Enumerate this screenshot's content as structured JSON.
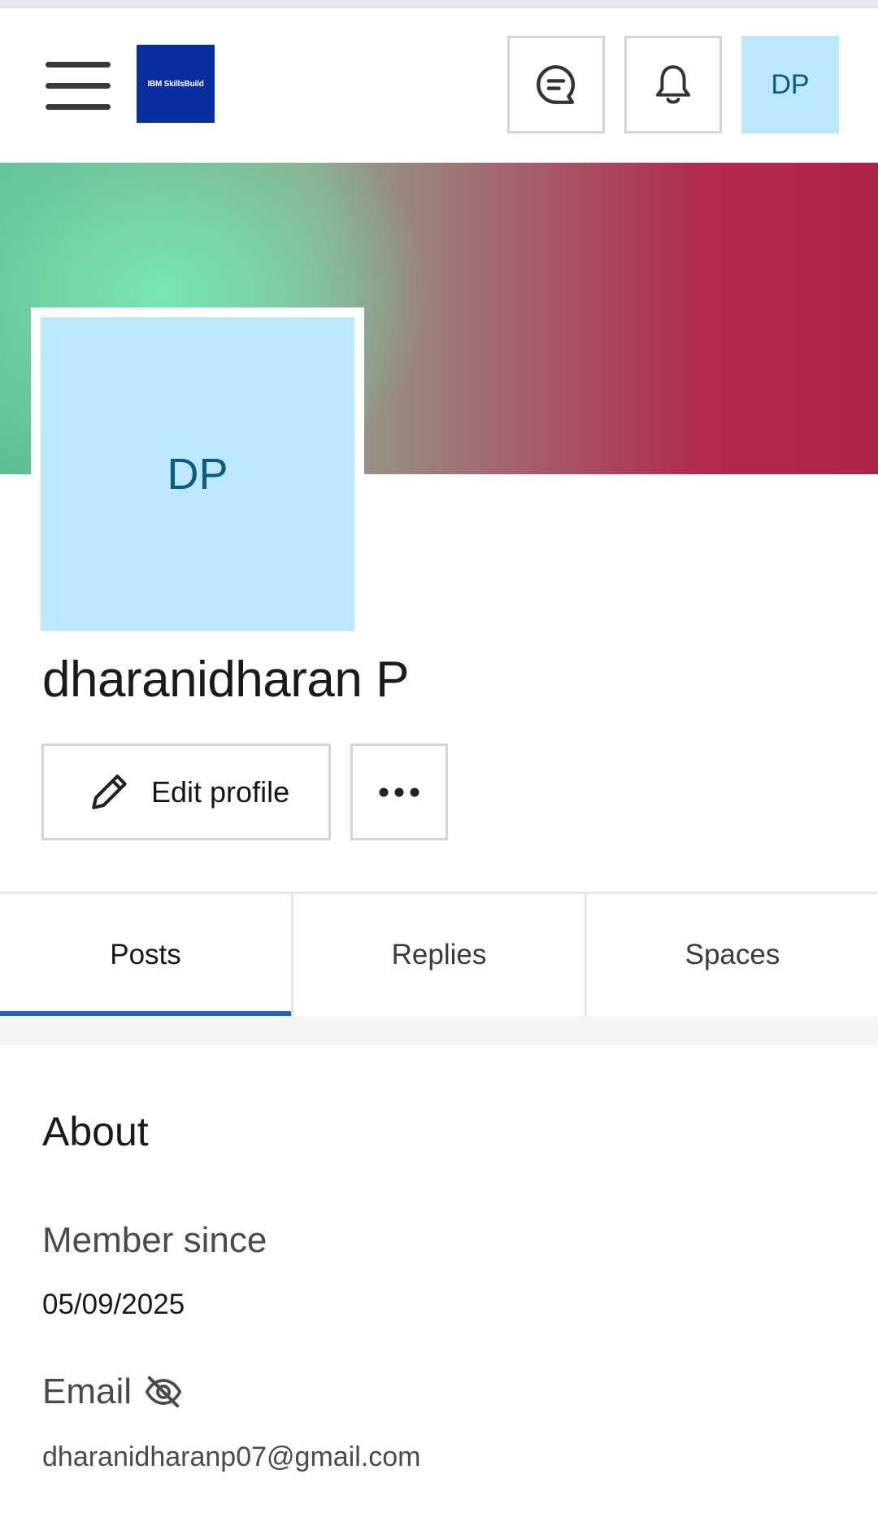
{
  "header": {
    "logo_text": "IBM SkillsBuild",
    "avatar_initials": "DP",
    "icons": [
      "menu-icon",
      "chat-icon",
      "bell-icon"
    ]
  },
  "profile": {
    "avatar_initials": "DP",
    "name": "dharanidharan P",
    "edit_label": "Edit profile"
  },
  "tabs": [
    {
      "label": "Posts",
      "active": true
    },
    {
      "label": "Replies",
      "active": false
    },
    {
      "label": "Spaces",
      "active": false
    }
  ],
  "about": {
    "title": "About",
    "member_since_label": "Member since",
    "member_since_value": "05/09/2025",
    "email_label": "Email",
    "email_value": "dharanidharanp07@gmail.com"
  },
  "colors": {
    "accent": "#1f5fdb",
    "avatar_bg": "#bde8fb",
    "avatar_text": "#0b5a8a",
    "logo_bg": "#0a2ea0"
  }
}
